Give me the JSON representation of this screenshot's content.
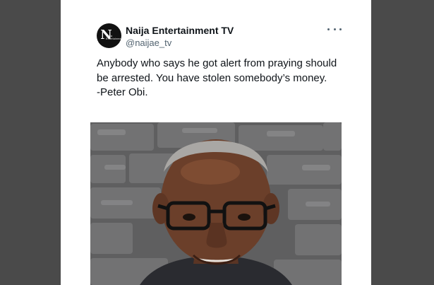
{
  "tweet": {
    "author_name": "Naija Entertainment TV",
    "author_handle": "@naijae_tv",
    "avatar_logo_letter": "N",
    "avatar_logo_text": "Naija Entertainment",
    "text_lines": [
      "Anybody who says he got alert from praying should",
      "be arrested. You have stolen somebody’s money.",
      "-Peter Obi."
    ],
    "more_icon": "more-horizontal-icon",
    "photo_subject": "portrait-photo"
  },
  "colors": {
    "page_background": "#4a4a4a",
    "card_background": "#ffffff",
    "text_primary": "#0f1419",
    "text_secondary": "#536471"
  }
}
